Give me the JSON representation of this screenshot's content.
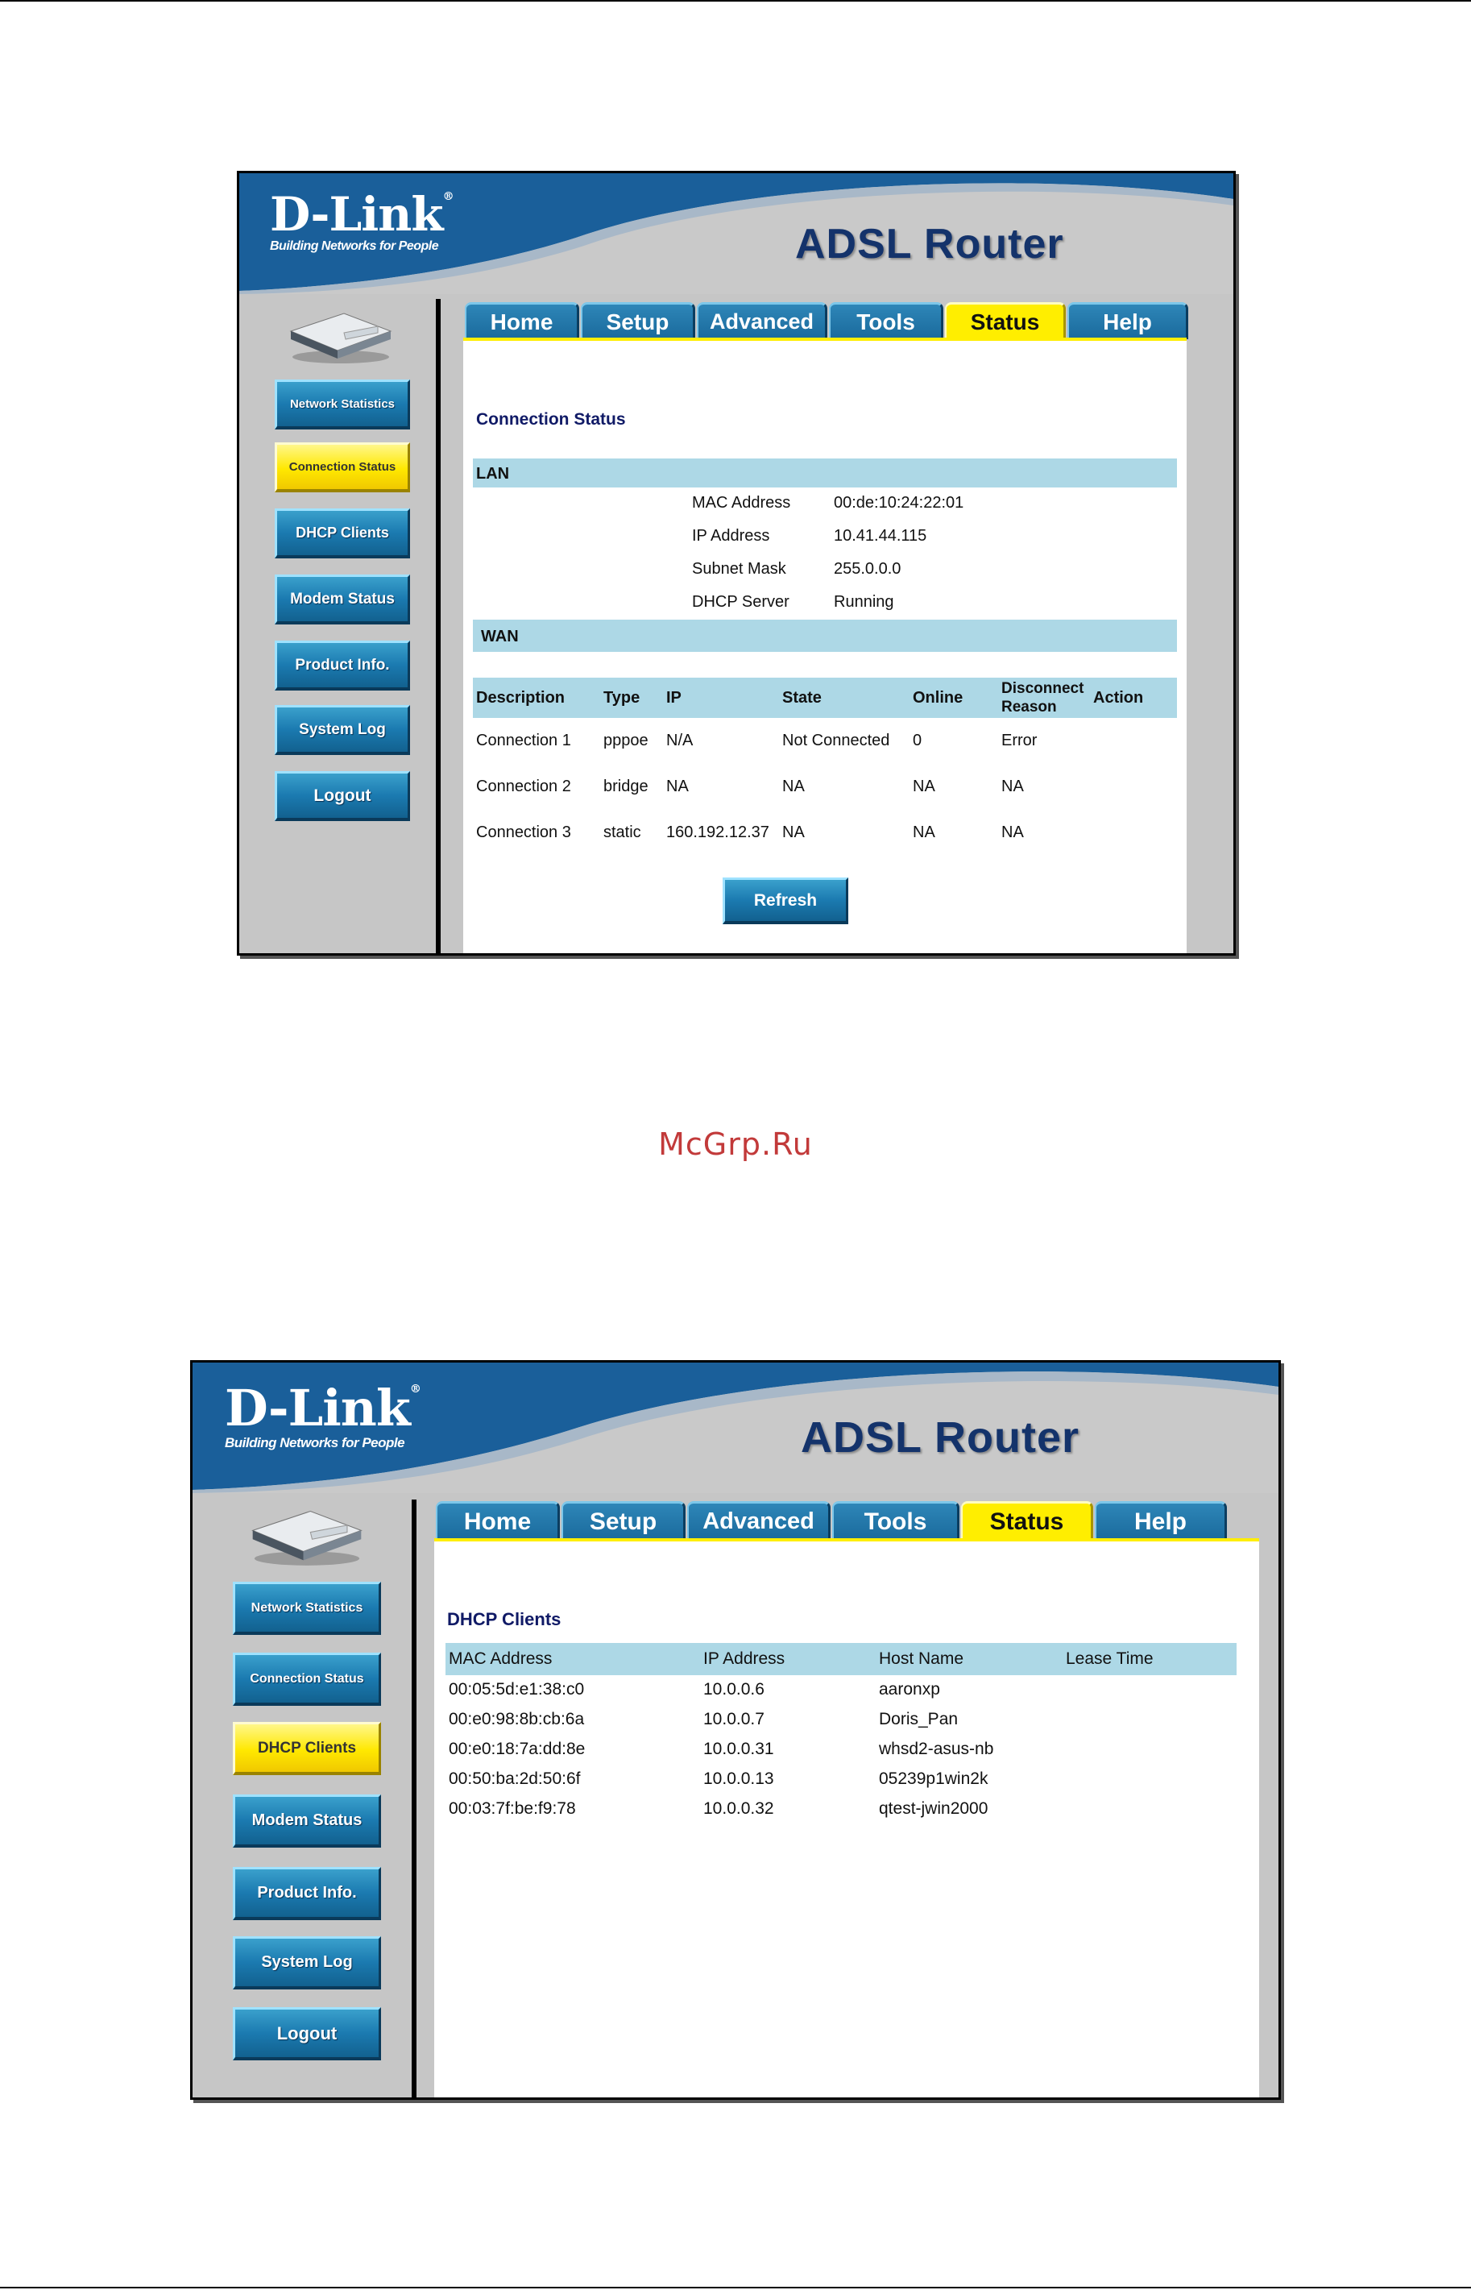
{
  "watermark": "McGrp.Ru",
  "brand": {
    "logo": "D-Link",
    "tagline": "Building Networks for People",
    "product": "ADSL Router"
  },
  "tabs": [
    "Home",
    "Setup",
    "Advanced",
    "Tools",
    "Status",
    "Help"
  ],
  "active_tab": "Status",
  "sidebar": [
    "Network Statistics",
    "Connection Status",
    "DHCP Clients",
    "Modem Status",
    "Product Info.",
    "System Log",
    "Logout"
  ],
  "screens": [
    {
      "active_sidebar": "Connection Status",
      "title": "Connection Status",
      "lan": {
        "label": "LAN",
        "rows": [
          {
            "label": "MAC Address",
            "value": "00:de:10:24:22:01"
          },
          {
            "label": "IP Address",
            "value": "10.41.44.115"
          },
          {
            "label": "Subnet Mask",
            "value": "255.0.0.0"
          },
          {
            "label": "DHCP Server",
            "value": "Running"
          }
        ]
      },
      "wan": {
        "label": "WAN",
        "headers": [
          "Description",
          "Type",
          "IP",
          "State",
          "Online",
          "Disconnect Reason",
          "Action"
        ],
        "rows": [
          [
            "Connection 1",
            "pppoe",
            "N/A",
            "Not Connected",
            "0",
            "Error",
            ""
          ],
          [
            "Connection 2",
            "bridge",
            "NA",
            "NA",
            "NA",
            "NA",
            ""
          ],
          [
            "Connection 3",
            "static",
            "160.192.12.37",
            "NA",
            "NA",
            "NA",
            ""
          ]
        ]
      },
      "refresh_label": "Refresh"
    },
    {
      "active_sidebar": "DHCP Clients",
      "title": "DHCP Clients",
      "headers": [
        "MAC Address",
        "IP Address",
        "Host Name",
        "Lease Time"
      ],
      "rows": [
        [
          "00:05:5d:e1:38:c0",
          "10.0.0.6",
          "aaronxp",
          ""
        ],
        [
          "00:e0:98:8b:cb:6a",
          "10.0.0.7",
          "Doris_Pan",
          ""
        ],
        [
          "00:e0:18:7a:dd:8e",
          "10.0.0.31",
          "whsd2-asus-nb",
          ""
        ],
        [
          "00:50:ba:2d:50:6f",
          "10.0.0.13",
          "05239p1win2k",
          ""
        ],
        [
          "00:03:7f:be:f9:78",
          "10.0.0.32",
          "qtest-jwin2000",
          ""
        ]
      ]
    }
  ],
  "colors": {
    "banner_blue": "#1a5f9a",
    "button_blue": "#1b7ab0",
    "active_yellow": "#ffee00",
    "band_blue": "#add8e6",
    "title_navy": "#101a66"
  }
}
